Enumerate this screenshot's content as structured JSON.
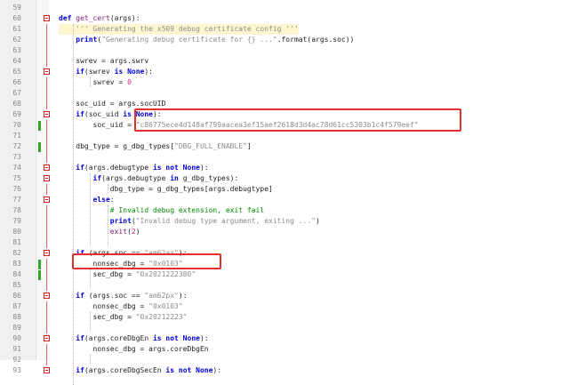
{
  "editor": {
    "lines": [
      {
        "num": "59",
        "changed": false,
        "tokens": []
      },
      {
        "num": "60",
        "changed": false,
        "tokens": [
          {
            "t": "kw",
            "v": "def"
          },
          {
            "t": "txt",
            "v": " "
          },
          {
            "t": "fn",
            "v": "get_cert"
          },
          {
            "t": "txt",
            "v": "(args):"
          }
        ]
      },
      {
        "num": "61",
        "changed": false,
        "hl": true,
        "tokens": [
          {
            "t": "txt",
            "v": "    "
          },
          {
            "t": "str",
            "v": "''' Generating the x509 debug certificate config '''"
          }
        ]
      },
      {
        "num": "62",
        "changed": false,
        "tokens": [
          {
            "t": "txt",
            "v": "    "
          },
          {
            "t": "kw",
            "v": "print"
          },
          {
            "t": "txt",
            "v": "("
          },
          {
            "t": "str",
            "v": "\"Generating debug certificate for {} ...\""
          },
          {
            "t": "txt",
            "v": ".format(args.soc))"
          }
        ]
      },
      {
        "num": "63",
        "changed": false,
        "tokens": []
      },
      {
        "num": "64",
        "changed": false,
        "tokens": [
          {
            "t": "txt",
            "v": "    swrev = args.swrv"
          }
        ]
      },
      {
        "num": "65",
        "changed": false,
        "tokens": [
          {
            "t": "txt",
            "v": "    "
          },
          {
            "t": "kw",
            "v": "if"
          },
          {
            "t": "txt",
            "v": "(swrev "
          },
          {
            "t": "kw",
            "v": "is None"
          },
          {
            "t": "txt",
            "v": "):"
          }
        ]
      },
      {
        "num": "66",
        "changed": false,
        "tokens": [
          {
            "t": "txt",
            "v": "        swrev = "
          },
          {
            "t": "num",
            "v": "0"
          }
        ]
      },
      {
        "num": "67",
        "changed": false,
        "tokens": []
      },
      {
        "num": "68",
        "changed": false,
        "tokens": [
          {
            "t": "txt",
            "v": "    soc_uid = args.socUID"
          }
        ]
      },
      {
        "num": "69",
        "changed": false,
        "tokens": [
          {
            "t": "txt",
            "v": "    "
          },
          {
            "t": "kw",
            "v": "if"
          },
          {
            "t": "txt",
            "v": "(soc_uid "
          },
          {
            "t": "kw",
            "v": "is None"
          },
          {
            "t": "txt",
            "v": "):"
          }
        ]
      },
      {
        "num": "70",
        "changed": true,
        "tokens": [
          {
            "t": "txt",
            "v": "        soc_uid = "
          },
          {
            "t": "str",
            "v": "\"c86775ece4d148af799aacea3ef15aef2618d3d4ac78d61cc5303b1c4f579eef\""
          }
        ]
      },
      {
        "num": "71",
        "changed": false,
        "tokens": []
      },
      {
        "num": "72",
        "changed": true,
        "tokens": [
          {
            "t": "txt",
            "v": "    dbg_type = g_dbg_types["
          },
          {
            "t": "str",
            "v": "\"DBG_FULL_ENABLE\""
          },
          {
            "t": "txt",
            "v": "]"
          }
        ]
      },
      {
        "num": "73",
        "changed": false,
        "tokens": []
      },
      {
        "num": "74",
        "changed": false,
        "tokens": [
          {
            "t": "txt",
            "v": "    "
          },
          {
            "t": "kw",
            "v": "if"
          },
          {
            "t": "txt",
            "v": "(args.debugtype "
          },
          {
            "t": "kw",
            "v": "is not None"
          },
          {
            "t": "txt",
            "v": "):"
          }
        ]
      },
      {
        "num": "75",
        "changed": false,
        "tokens": [
          {
            "t": "txt",
            "v": "        "
          },
          {
            "t": "kw",
            "v": "if"
          },
          {
            "t": "txt",
            "v": "(args.debugtype "
          },
          {
            "t": "kw",
            "v": "in"
          },
          {
            "t": "txt",
            "v": " g_dbg_types):"
          }
        ]
      },
      {
        "num": "76",
        "changed": false,
        "tokens": [
          {
            "t": "txt",
            "v": "            dbg_type = g_dbg_types[args.debugtype]"
          }
        ]
      },
      {
        "num": "77",
        "changed": false,
        "tokens": [
          {
            "t": "txt",
            "v": "        "
          },
          {
            "t": "kw",
            "v": "else"
          },
          {
            "t": "txt",
            "v": ":"
          }
        ]
      },
      {
        "num": "78",
        "changed": false,
        "tokens": [
          {
            "t": "txt",
            "v": "            "
          },
          {
            "t": "cmt",
            "v": "# Invalid debug extension, exit fail"
          }
        ]
      },
      {
        "num": "79",
        "changed": false,
        "tokens": [
          {
            "t": "txt",
            "v": "            "
          },
          {
            "t": "kw",
            "v": "print"
          },
          {
            "t": "txt",
            "v": "("
          },
          {
            "t": "str",
            "v": "\"Invalid debug type argument, exiting ...\""
          },
          {
            "t": "txt",
            "v": ")"
          }
        ]
      },
      {
        "num": "80",
        "changed": false,
        "tokens": [
          {
            "t": "txt",
            "v": "            "
          },
          {
            "t": "fn",
            "v": "exit"
          },
          {
            "t": "txt",
            "v": "("
          },
          {
            "t": "num",
            "v": "2"
          },
          {
            "t": "txt",
            "v": ")"
          }
        ]
      },
      {
        "num": "81",
        "changed": false,
        "tokens": []
      },
      {
        "num": "82",
        "changed": false,
        "tokens": [
          {
            "t": "txt",
            "v": "    "
          },
          {
            "t": "kw",
            "v": "if"
          },
          {
            "t": "txt",
            "v": " (args.soc == "
          },
          {
            "t": "str",
            "v": "\"am62ax\""
          },
          {
            "t": "txt",
            "v": "):"
          }
        ]
      },
      {
        "num": "83",
        "changed": true,
        "tokens": [
          {
            "t": "txt",
            "v": "        nonsec_dbg = "
          },
          {
            "t": "str",
            "v": "\"0x0103\""
          }
        ]
      },
      {
        "num": "84",
        "changed": true,
        "tokens": [
          {
            "t": "txt",
            "v": "        sec_dbg = "
          },
          {
            "t": "str",
            "v": "\"0x2021222380\""
          }
        ]
      },
      {
        "num": "85",
        "changed": false,
        "tokens": []
      },
      {
        "num": "86",
        "changed": false,
        "tokens": [
          {
            "t": "txt",
            "v": "    "
          },
          {
            "t": "kw",
            "v": "if"
          },
          {
            "t": "txt",
            "v": " (args.soc == "
          },
          {
            "t": "str",
            "v": "\"am62px\""
          },
          {
            "t": "txt",
            "v": "):"
          }
        ]
      },
      {
        "num": "87",
        "changed": false,
        "tokens": [
          {
            "t": "txt",
            "v": "        nonsec_dbg = "
          },
          {
            "t": "str",
            "v": "\"0x0103\""
          }
        ]
      },
      {
        "num": "88",
        "changed": false,
        "tokens": [
          {
            "t": "txt",
            "v": "        sec_dbg = "
          },
          {
            "t": "str",
            "v": "\"0x20212223\""
          }
        ]
      },
      {
        "num": "89",
        "changed": false,
        "tokens": []
      },
      {
        "num": "90",
        "changed": false,
        "tokens": [
          {
            "t": "txt",
            "v": "    "
          },
          {
            "t": "kw",
            "v": "if"
          },
          {
            "t": "txt",
            "v": "(args.coreDbgEn "
          },
          {
            "t": "kw",
            "v": "is not None"
          },
          {
            "t": "txt",
            "v": "):"
          }
        ]
      },
      {
        "num": "91",
        "changed": false,
        "tokens": [
          {
            "t": "txt",
            "v": "        nonsec_dbg = args.coreDbgEn"
          }
        ]
      },
      {
        "num": "92",
        "changed": false,
        "tokens": []
      },
      {
        "num": "93",
        "changed": false,
        "tokens": [
          {
            "t": "txt",
            "v": "    "
          },
          {
            "t": "kw",
            "v": "if"
          },
          {
            "t": "txt",
            "v": "(args.coreDbgSecEn "
          },
          {
            "t": "kw",
            "v": "is not None"
          },
          {
            "t": "txt",
            "v": "):"
          }
        ]
      }
    ]
  },
  "colors": {
    "keyword": "#0000dd",
    "string": "#8c8c8c",
    "number": "#e0208c",
    "comment": "#009000",
    "function": "#7a1f6b",
    "change_marker": "#2fa52f",
    "annotation_box": "#e03030"
  },
  "annotations": [
    {
      "name": "soc-uid-highlight",
      "line": "70"
    },
    {
      "name": "sec-dbg-highlight",
      "line": "84"
    }
  ]
}
